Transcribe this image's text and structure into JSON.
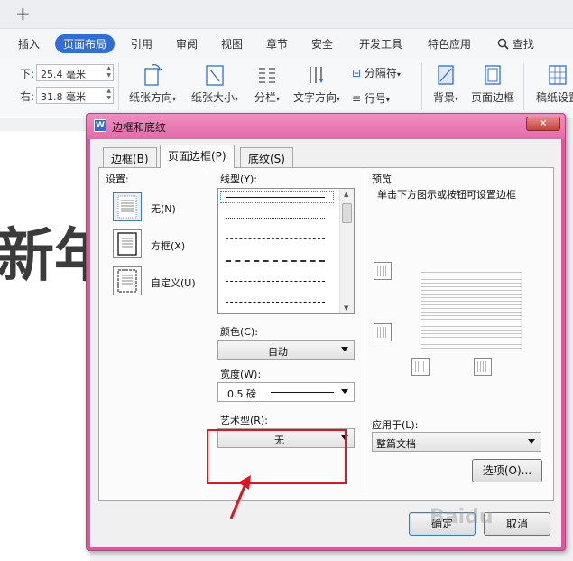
{
  "toolbar": {
    "new_tab": "+"
  },
  "ribbon_tabs": [
    {
      "label": "插入"
    },
    {
      "label": "页面布局",
      "active": true
    },
    {
      "label": "引用"
    },
    {
      "label": "审阅"
    },
    {
      "label": "视图"
    },
    {
      "label": "章节"
    },
    {
      "label": "安全"
    },
    {
      "label": "开发工具"
    },
    {
      "label": "特色应用"
    },
    {
      "label": "查找"
    }
  ],
  "margins": {
    "bottom_label": "下:",
    "bottom_value": "25.4 毫米",
    "right_label": "右:",
    "right_value": "31.8 毫米"
  },
  "ribbon_buttons": {
    "orientation": "纸张方向",
    "size": "纸张大小",
    "columns": "分栏",
    "text_direction": "文字方向",
    "separator": "分隔符",
    "line_number": "行号",
    "background": "背景",
    "page_border": "页面边框",
    "manuscript": "稿纸设置"
  },
  "doc": {
    "big_text": "新年"
  },
  "dialog": {
    "title": "边框和底纹",
    "close": "✕",
    "tabs": [
      "边框(B)",
      "页面边框(P)",
      "底纹(S)"
    ],
    "setting_label": "设置:",
    "settings": [
      {
        "label": "无(N)"
      },
      {
        "label": "方框(X)"
      },
      {
        "label": "自定义(U)"
      }
    ],
    "style_label": "线型(Y):",
    "color_label": "颜色(C):",
    "color_value": "自动",
    "width_label": "宽度(W):",
    "width_value": "0.5  磅",
    "art_label": "艺术型(R):",
    "art_value": "无",
    "preview_label": "预览",
    "preview_hint": "单击下方图示或按钮可设置边框",
    "apply_label": "应用于(L):",
    "apply_value": "整篇文档",
    "options_button": "选项(O)...",
    "ok_button": "确定",
    "cancel_button": "取消"
  },
  "watermark": "Baidu"
}
